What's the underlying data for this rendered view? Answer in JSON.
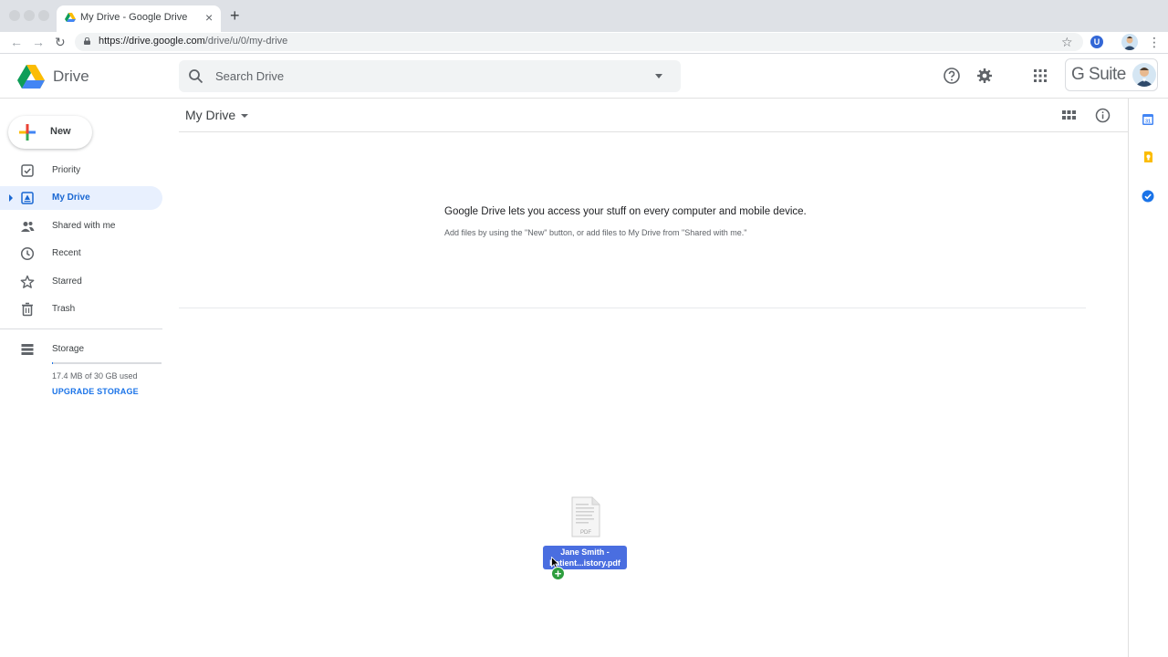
{
  "browser": {
    "tab_title": "My Drive - Google Drive",
    "tab_close": "×",
    "new_tab": "+",
    "url_host": "https://drive.google.com",
    "url_path": "/drive/u/0/my-drive",
    "back": "←",
    "forward": "→",
    "reload": "↻",
    "bookmark_star": "☆",
    "extension_letter": "U",
    "menu": "⋮"
  },
  "header": {
    "app_name": "Drive",
    "search_placeholder": "Search Drive",
    "gsuite_label": "G Suite"
  },
  "sidebar": {
    "new_label": "New",
    "items": [
      {
        "label": "Priority",
        "icon": "priority-icon"
      },
      {
        "label": "My Drive",
        "icon": "my-drive-icon",
        "active": true
      },
      {
        "label": "Shared with me",
        "icon": "shared-icon"
      },
      {
        "label": "Recent",
        "icon": "clock-icon"
      },
      {
        "label": "Starred",
        "icon": "star-icon"
      },
      {
        "label": "Trash",
        "icon": "trash-icon"
      }
    ],
    "storage_label": "Storage",
    "storage_used": "17.4 MB of 30 GB used",
    "storage_fraction": 0.0006,
    "upgrade_label": "UPGRADE STORAGE"
  },
  "main": {
    "breadcrumb": "My Drive",
    "empty_title": "Google Drive lets you access your stuff on every computer and mobile device.",
    "empty_subtitle": "Add files by using the \"New\" button, or add files to My Drive from \"Shared with me.\""
  },
  "drag": {
    "file_line1": "Jane Smith -",
    "file_line2": "Patient...istory.pdf",
    "file_type": "PDF",
    "copy_badge": "+"
  },
  "colors": {
    "accent_blue": "#1a73e8",
    "active_bg": "#e8f0fe",
    "drag_label_bg": "#4a6ee0",
    "copy_green": "#2e9e3e"
  }
}
